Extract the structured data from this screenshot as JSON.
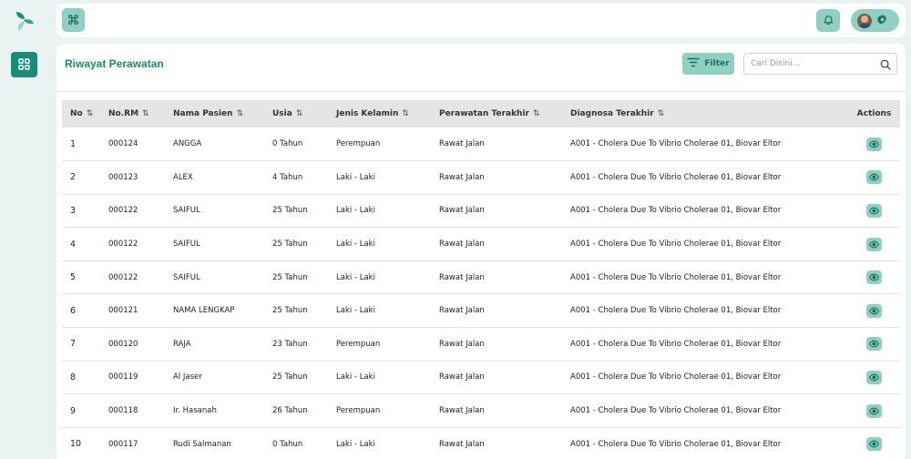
{
  "header": {
    "title": "Riwayat Perawatan"
  },
  "toolbar": {
    "filter_label": "Filter",
    "search_placeholder": "Cari Disini..."
  },
  "table": {
    "columns": [
      "No",
      "No.RM",
      "Nama Pasien",
      "Usia",
      "Jenis Kelamin",
      "Perawatan Terakhir",
      "Diagnosa Terakhir",
      "Actions"
    ],
    "sort_glyph": "⇅",
    "rows": [
      {
        "no": "1",
        "rm": "000124",
        "name": "ANGGA",
        "age": "0 Tahun",
        "gender": "Perempuan",
        "care": "Rawat Jalan",
        "diagnosis": "A001 - Cholera Due To Vibrio Cholerae 01, Biovar Eltor"
      },
      {
        "no": "2",
        "rm": "000123",
        "name": "ALEX",
        "age": "4 Tahun",
        "gender": "Laki - Laki",
        "care": "Rawat Jalan",
        "diagnosis": "A001 - Cholera Due To Vibrio Cholerae 01, Biovar Eltor"
      },
      {
        "no": "3",
        "rm": "000122",
        "name": "SAIFUL",
        "age": "25 Tahun",
        "gender": "Laki - Laki",
        "care": "Rawat Jalan",
        "diagnosis": "A001 - Cholera Due To Vibrio Cholerae 01, Biovar Eltor"
      },
      {
        "no": "4",
        "rm": "000122",
        "name": "SAIFUL",
        "age": "25 Tahun",
        "gender": "Laki - Laki",
        "care": "Rawat Jalan",
        "diagnosis": "A001 - Cholera Due To Vibrio Cholerae 01, Biovar Eltor"
      },
      {
        "no": "5",
        "rm": "000122",
        "name": "SAIFUL",
        "age": "25 Tahun",
        "gender": "Laki - Laki",
        "care": "Rawat Jalan",
        "diagnosis": "A001 - Cholera Due To Vibrio Cholerae 01, Biovar Eltor"
      },
      {
        "no": "6",
        "rm": "000121",
        "name": "NAMA LENGKAP",
        "age": "25 Tahun",
        "gender": "Laki - Laki",
        "care": "Rawat Jalan",
        "diagnosis": "A001 - Cholera Due To Vibrio Cholerae 01, Biovar Eltor"
      },
      {
        "no": "7",
        "rm": "000120",
        "name": "RAJA",
        "age": "23 Tahun",
        "gender": "Perempuan",
        "care": "Rawat Jalan",
        "diagnosis": "A001 - Cholera Due To Vibrio Cholerae 01, Biovar Eltor"
      },
      {
        "no": "8",
        "rm": "000119",
        "name": "Al Jaser",
        "age": "25 Tahun",
        "gender": "Laki - Laki",
        "care": "Rawat Jalan",
        "diagnosis": "A001 - Cholera Due To Vibrio Cholerae 01, Biovar Eltor"
      },
      {
        "no": "9",
        "rm": "000118",
        "name": "Ir. Hasanah",
        "age": "26 Tahun",
        "gender": "Perempuan",
        "care": "Rawat Jalan",
        "diagnosis": "A001 - Cholera Due To Vibrio Cholerae 01, Biovar Eltor"
      },
      {
        "no": "10",
        "rm": "000117",
        "name": "Rudi Salmanan",
        "age": "0 Tahun",
        "gender": "Laki - Laki",
        "care": "Rawat Jalan",
        "diagnosis": "A001 - Cholera Due To Vibrio Cholerae 01, Biovar Eltor"
      }
    ]
  },
  "icons": {
    "logo": "logo-icon",
    "nav": "dashboard-grid-icon",
    "command": "command-icon",
    "notification": "bell-icon",
    "settings": "gear-icon",
    "filter": "filter-icon",
    "search": "search-icon",
    "view": "eye-icon"
  },
  "colors": {
    "primary": "#1c8a78",
    "accent": "#8fd0c3",
    "title": "#1a8a72",
    "background": "#eaf3f2"
  }
}
